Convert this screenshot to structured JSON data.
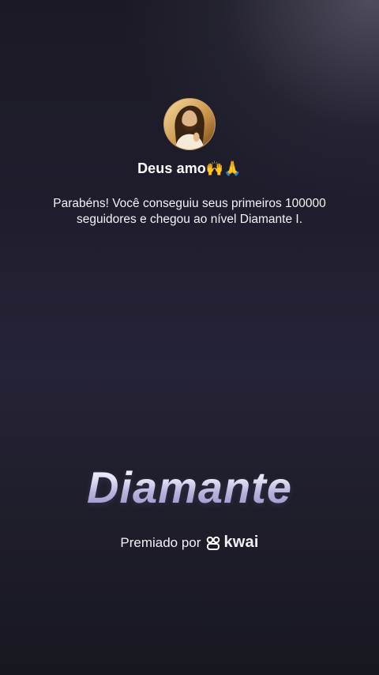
{
  "profile": {
    "username": "Deus amo🙌🙏",
    "avatar_icon": "person-portrait"
  },
  "message": {
    "line1": "Parabéns! Você conseguiu seus primeiros 100000",
    "line2": "seguidores e chegou ao nível Diamante I."
  },
  "level": {
    "title": "Diamante"
  },
  "award": {
    "prefix": "Premiado por",
    "brand": "kwai",
    "brand_icon": "kwai-logo-icon"
  },
  "colors": {
    "background_top": "#1b1a24",
    "background_mid": "#252336",
    "text": "#ffffff",
    "title_gradient_end": "#8f8cc8"
  }
}
